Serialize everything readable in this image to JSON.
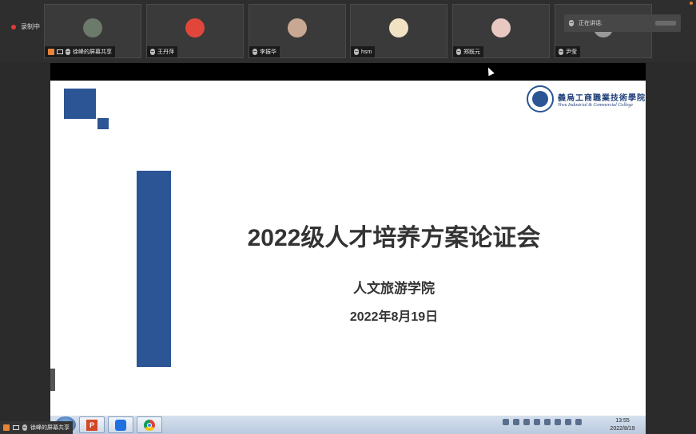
{
  "recording": {
    "label": "录制中"
  },
  "participants": [
    {
      "name": "徐峰的屏幕共享",
      "sharing": true
    },
    {
      "name": "王丹萍"
    },
    {
      "name": "李振华"
    },
    {
      "name": "hsm"
    },
    {
      "name": "郑既元"
    },
    {
      "name": "尹莹"
    }
  ],
  "speaking": {
    "label": "正在讲话:"
  },
  "slide": {
    "logo_cn": "義烏工商職業技術學院",
    "logo_en": "Yiwu Industrial & Commercial College",
    "title": "2022级人才培养方案论证会",
    "subtitle": "人文旅游学院",
    "date": "2022年8月19日"
  },
  "taskbar": {
    "clock_time": "13:55",
    "clock_date": "2022/8/19",
    "ppt_letter": "P"
  },
  "bottom_share": {
    "label": "徐峰的屏幕共享"
  },
  "colors": {
    "accent": "#2b5595",
    "record": "#e03b3b"
  }
}
